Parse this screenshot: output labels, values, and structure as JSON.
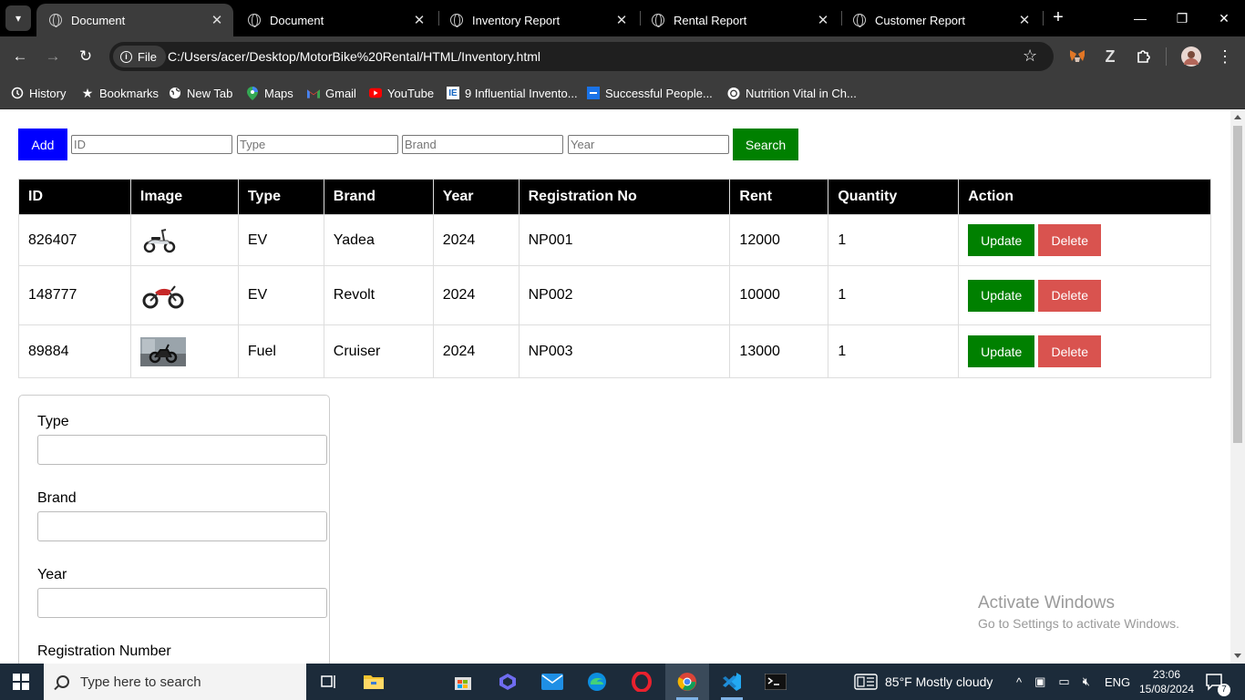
{
  "browser": {
    "tabs": [
      {
        "title": "Document",
        "active": true
      },
      {
        "title": "Document",
        "active": false
      },
      {
        "title": "Inventory Report",
        "active": false
      },
      {
        "title": "Rental Report",
        "active": false
      },
      {
        "title": "Customer Report",
        "active": false
      }
    ],
    "address_chip": "File",
    "url": "C:/Users/acer/Desktop/MotorBike%20Rental/HTML/Inventory.html",
    "bookmarks": [
      {
        "label": "History",
        "icon": "history-icon"
      },
      {
        "label": "Bookmarks",
        "icon": "star-icon"
      },
      {
        "label": "New Tab",
        "icon": "globe-icon"
      },
      {
        "label": "Maps",
        "icon": "maps-pin-icon"
      },
      {
        "label": "Gmail",
        "icon": "gmail-icon"
      },
      {
        "label": "YouTube",
        "icon": "youtube-icon"
      },
      {
        "label": "9 Influential Invento...",
        "icon": "ie-logo-icon"
      },
      {
        "label": "Successful People...",
        "icon": "blue-tile-icon"
      },
      {
        "label": "Nutrition Vital in Ch...",
        "icon": "openai-icon"
      }
    ]
  },
  "toolbar": {
    "add_label": "Add",
    "search_label": "Search",
    "placeholders": {
      "id": "ID",
      "type": "Type",
      "brand": "Brand",
      "year": "Year"
    }
  },
  "table": {
    "headers": [
      "ID",
      "Image",
      "Type",
      "Brand",
      "Year",
      "Registration No",
      "Rent",
      "Quantity",
      "Action"
    ],
    "rows": [
      {
        "id": "826407",
        "image": "scooter",
        "type": "EV",
        "brand": "Yadea",
        "year": "2024",
        "reg": "NP001",
        "rent": "12000",
        "qty": "1"
      },
      {
        "id": "148777",
        "image": "red-motorbike",
        "type": "EV",
        "brand": "Revolt",
        "year": "2024",
        "reg": "NP002",
        "rent": "10000",
        "qty": "1"
      },
      {
        "id": "89884",
        "image": "cruiser-photo",
        "type": "Fuel",
        "brand": "Cruiser",
        "year": "2024",
        "reg": "NP003",
        "rent": "13000",
        "qty": "1"
      }
    ],
    "update_label": "Update",
    "delete_label": "Delete"
  },
  "form": {
    "fields": [
      "Type",
      "Brand",
      "Year",
      "Registration Number"
    ]
  },
  "watermark": {
    "title": "Activate Windows",
    "subtitle": "Go to Settings to activate Windows."
  },
  "taskbar": {
    "search_placeholder": "Type here to search",
    "weather": "85°F  Mostly cloudy",
    "lang": "ENG",
    "time": "23:06",
    "date": "15/08/2024",
    "notifications": "7"
  },
  "colors": {
    "add": "#0000ff",
    "search": "#008000",
    "update": "#008000",
    "delete": "#d9534f",
    "header_bg": "#000000"
  }
}
